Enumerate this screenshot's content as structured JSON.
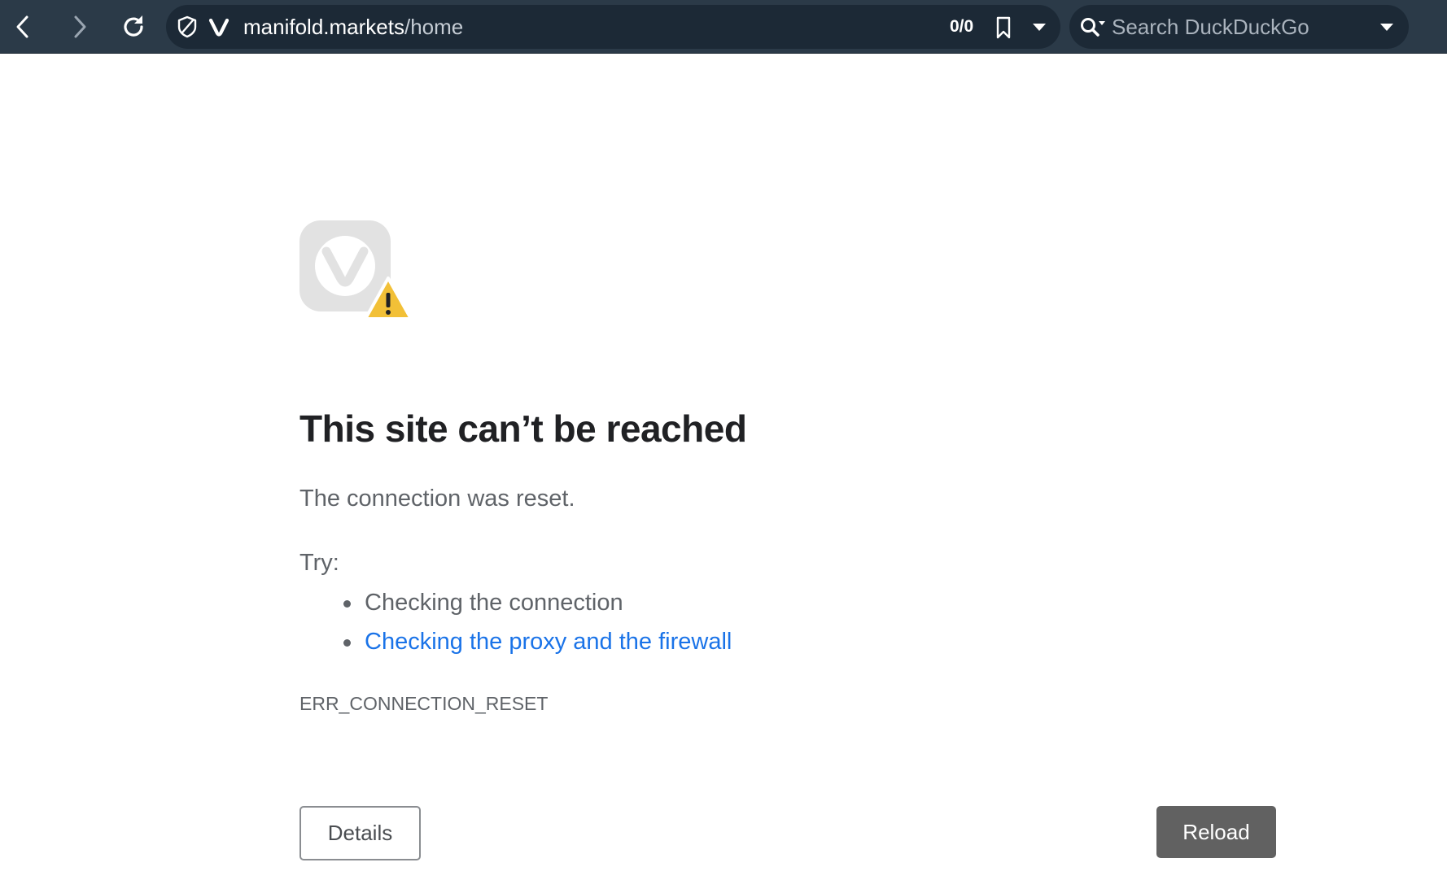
{
  "browser": {
    "address_bar": {
      "url_host": "manifold.markets",
      "url_path": "/home",
      "blocked_counter": "0/0"
    },
    "search": {
      "placeholder": "Search DuckDuckGo"
    },
    "icons": [
      "back-icon",
      "forward-icon",
      "reload-icon",
      "shield-icon",
      "vivaldi-icon",
      "bookmark-icon",
      "chevron-down-icon",
      "search-icon"
    ]
  },
  "error_page": {
    "title": "This site can’t be reached",
    "message": "The connection was reset.",
    "try_label": "Try:",
    "suggestions": [
      "Checking the connection",
      "Checking the proxy and the firewall"
    ],
    "error_code": "ERR_CONNECTION_RESET",
    "details_label": "Details",
    "reload_label": "Reload",
    "colors": {
      "link": "#1a73e8",
      "warning": "#f2c037",
      "reload_button": "#616161"
    }
  }
}
